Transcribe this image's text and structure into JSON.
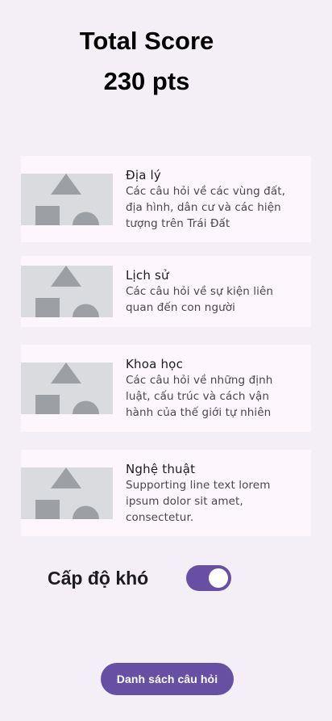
{
  "score": {
    "title": "Total Score",
    "value": "230 pts"
  },
  "categories": [
    {
      "title": "Địa lý",
      "description": "Các câu hỏi về các vùng đất, địa hình, dân cư và các hiện tượng trên Trái Đất",
      "thumbnail_icon": "image-placeholder-icon"
    },
    {
      "title": "Lịch sử",
      "description": "Các câu hỏi về sự kiện liên quan đến con người",
      "thumbnail_icon": "image-placeholder-icon"
    },
    {
      "title": "Khoa học",
      "description": "Các câu hỏi về những định luật, cấu trúc và cách vận hành của thế giới tự nhiên",
      "thumbnail_icon": "image-placeholder-icon"
    },
    {
      "title": "Nghệ thuật",
      "description": "Supporting line text lorem ipsum dolor sit amet, consectetur.",
      "thumbnail_icon": "image-placeholder-icon"
    }
  ],
  "difficulty": {
    "label": "Cấp độ khó",
    "enabled": true
  },
  "actions": {
    "question_list_label": "Danh sách câu hỏi"
  },
  "colors": {
    "background": "#f4eff7",
    "card": "#fdf7fd",
    "primary": "#6750a4",
    "placeholder": "#dadbde",
    "placeholder_shapes": "#9c9fa4"
  }
}
